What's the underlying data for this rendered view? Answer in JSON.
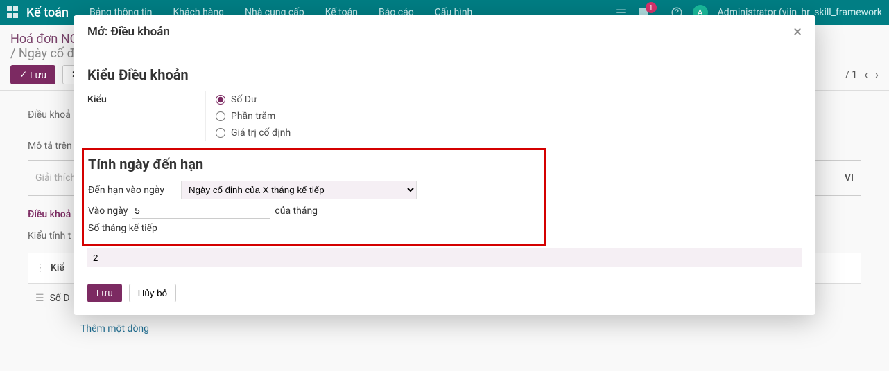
{
  "nav": {
    "brand": "Kế toán",
    "items": [
      "Bảng thông tin",
      "Khách hàng",
      "Nhà cung cấp",
      "Kế toán",
      "Báo cáo",
      "Cấu hình"
    ],
    "badge": "1",
    "avatar_letter": "A",
    "user": "Administrator (viin_hr_skill_framework"
  },
  "breadcrumb": {
    "root": "Hoá đơn NC",
    "current": "/ Ngày cố đ"
  },
  "actions": {
    "save": "Lưu",
    "discard_prefix": "H"
  },
  "pager": {
    "text": "/ 1"
  },
  "bg": {
    "section1": "Điều khoả",
    "desc_label": "Mô tả trên",
    "placeholder": "Giải thích",
    "lang_badge": "VI",
    "tab": "Điều khoả",
    "row_label": "Kiểu tính t",
    "th": "Kiể",
    "td": "Số D",
    "add": "Thêm một dòng"
  },
  "modal": {
    "title": "Mở: Điều khoản",
    "section_type": "Kiểu Điều khoản",
    "type_label": "Kiểu",
    "radios": {
      "balance": "Số Dư",
      "percent": "Phần trăm",
      "fixed": "Giá trị cố định"
    },
    "section_due": "Tính ngày đến hạn",
    "due_label": "Đến hạn vào ngày",
    "due_select": "Ngày cố định của X tháng kế tiếp",
    "onday_prefix": "Vào ngày",
    "onday_value": "5",
    "onday_suffix": "của tháng",
    "months_label": "Số tháng kế tiếp",
    "months_value": "2",
    "save": "Lưu",
    "cancel": "Hủy bỏ"
  }
}
